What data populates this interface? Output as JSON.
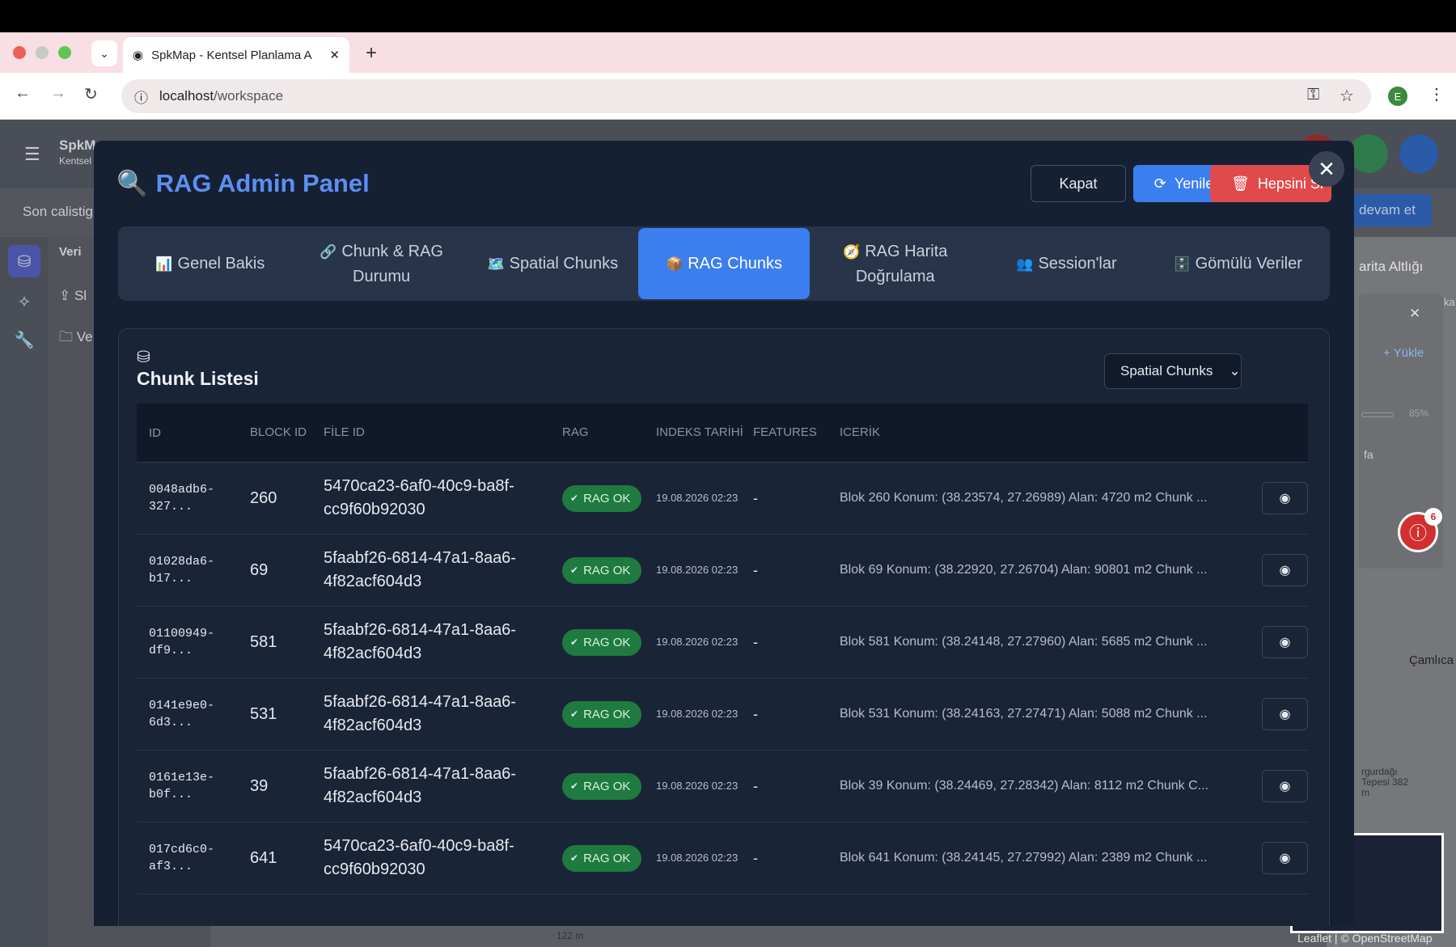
{
  "browser": {
    "tab_title": "SpkMap - Kentsel Planlama A",
    "url_host": "localhost",
    "url_path": "/workspace",
    "profile_initial": "E"
  },
  "app": {
    "brand": "SpkM",
    "brand_sub": "Kentsel",
    "subheader_text": "Son calistig",
    "panel_title": "Veri",
    "panel_item1": "Sl",
    "panel_item2": "Ve",
    "continue_button": "devam et",
    "map_layer": "arita Altlığı",
    "upload_label": "+ Yükle",
    "opacity_value": "85%",
    "map_label_cumlica": "Çamlıca",
    "map_label_hill": "rgurdağı Tepesi 382 m",
    "map_label_fa": "fa",
    "map_label_ka": "ka",
    "scale_label": "122 m",
    "map_attribution": "Leaflet | © OpenStreetMap",
    "alert_count": "6"
  },
  "modal": {
    "title": "RAG Admin Panel",
    "buttons": {
      "close": "Kapat",
      "refresh": "Yenile",
      "delete_all": "Hepsini Si"
    },
    "tabs": [
      {
        "icon": "📊",
        "label": "Genel Bakis"
      },
      {
        "icon": "🔗",
        "label": "Chunk & RAG Durumu"
      },
      {
        "icon": "🗺️",
        "label": "Spatial Chunks"
      },
      {
        "icon": "📦",
        "label": "RAG Chunks"
      },
      {
        "icon": "🧭",
        "label": "RAG Harita Doğrulama"
      },
      {
        "icon": "👥",
        "label": "Session'lar"
      },
      {
        "icon": "🗄️",
        "label": "Gömülü Veriler"
      }
    ],
    "active_tab": "RAG Chunks",
    "list": {
      "title": "Chunk Listesi",
      "select_value": "Spatial Chunks",
      "columns": {
        "id": "ID",
        "block_id": "BLOCK ID",
        "file_id": "FİLE ID",
        "rag": "RAG",
        "index_date": "INDEKS TARİHİ",
        "features": "FEATURES",
        "content": "ICERİK"
      },
      "rows": [
        {
          "id": "0048adb6-327...",
          "block": "260",
          "file": "5470ca23-6af0-40c9-ba8f-cc9f60b92030",
          "rag": "RAG OK",
          "date": "19.08.2026 02:23",
          "features": "-",
          "content": "Blok 260 Konum: (38.23574, 27.26989) Alan: 4720 m2 Chunk ..."
        },
        {
          "id": "01028da6-b17...",
          "block": "69",
          "file": "5faabf26-6814-47a1-8aa6-4f82acf604d3",
          "rag": "RAG OK",
          "date": "19.08.2026 02:23",
          "features": "-",
          "content": "Blok 69 Konum: (38.22920, 27.26704) Alan: 90801 m2 Chunk ..."
        },
        {
          "id": "01100949-df9...",
          "block": "581",
          "file": "5faabf26-6814-47a1-8aa6-4f82acf604d3",
          "rag": "RAG OK",
          "date": "19.08.2026 02:23",
          "features": "-",
          "content": "Blok 581 Konum: (38.24148, 27.27960) Alan: 5685 m2 Chunk ..."
        },
        {
          "id": "0141e9e0-6d3...",
          "block": "531",
          "file": "5faabf26-6814-47a1-8aa6-4f82acf604d3",
          "rag": "RAG OK",
          "date": "19.08.2026 02:23",
          "features": "-",
          "content": "Blok 531 Konum: (38.24163, 27.27471) Alan: 5088 m2 Chunk ..."
        },
        {
          "id": "0161e13e-b0f...",
          "block": "39",
          "file": "5faabf26-6814-47a1-8aa6-4f82acf604d3",
          "rag": "RAG OK",
          "date": "19.08.2026 02:23",
          "features": "-",
          "content": "Blok 39 Konum: (38.24469, 27.28342) Alan: 8112 m2 Chunk C..."
        },
        {
          "id": "017cd6c0-af3...",
          "block": "641",
          "file": "5470ca23-6af0-40c9-ba8f-cc9f60b92030",
          "rag": "RAG OK",
          "date": "19.08.2026 02:23",
          "features": "-",
          "content": "Blok 641 Konum: (38.24145, 27.27992) Alan: 2389 m2 Chunk ..."
        }
      ]
    }
  },
  "colors": {
    "modal_bg": "#162033",
    "accent_blue": "#3b7ef0",
    "danger_red": "#e14a4a",
    "success_green": "#1f7a3f",
    "title_blue": "#5d8ff2"
  }
}
